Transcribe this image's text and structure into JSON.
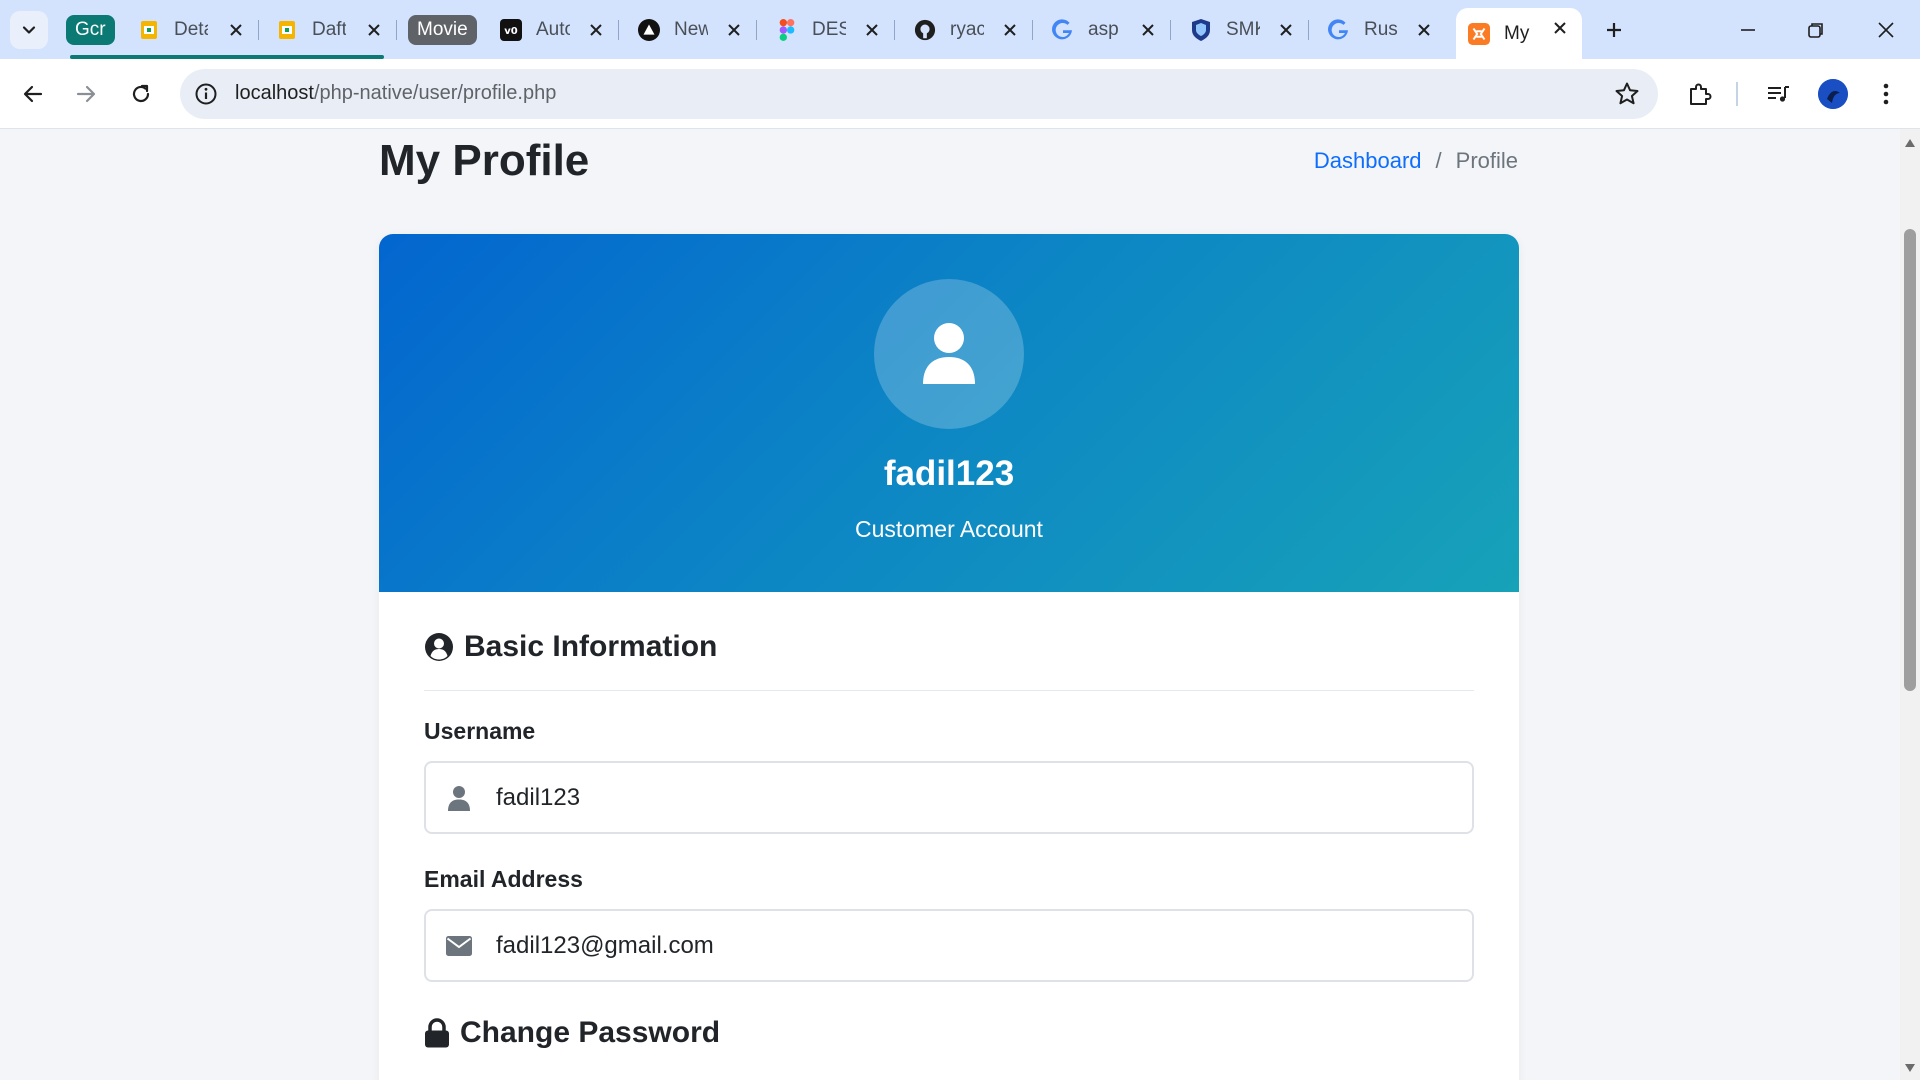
{
  "colors": {
    "tabstrip": "#d3e3fd",
    "accent_blue": "#0d6efd",
    "hero_gradient_start": "#0366d0",
    "hero_gradient_end": "#17a2b8",
    "tab_group_gcr": "#0b7a74",
    "tab_group_movie": "#5f6368"
  },
  "browser": {
    "tab_groups": [
      {
        "label": "Gcr"
      },
      {
        "label": "Movie"
      }
    ],
    "tabs": [
      {
        "title": "Deta",
        "icon": "google-sheets-icon"
      },
      {
        "title": "Daft",
        "icon": "google-sheets-icon"
      },
      {
        "title": "Auto",
        "icon": "v0-icon"
      },
      {
        "title": "New",
        "icon": "triangle-logo-icon"
      },
      {
        "title": "DES",
        "icon": "figma-icon"
      },
      {
        "title": "ryac",
        "icon": "github-icon"
      },
      {
        "title": "asp",
        "icon": "google-icon"
      },
      {
        "title": "SMK",
        "icon": "shield-logo-icon"
      },
      {
        "title": "Rus",
        "icon": "google-icon"
      },
      {
        "title": "My",
        "icon": "xampp-icon",
        "active": true
      }
    ],
    "url_host": "localhost",
    "url_path": "/php-native/user/profile.php"
  },
  "page": {
    "title": "My Profile",
    "breadcrumb": {
      "home": "Dashboard",
      "separator": "/",
      "current": "Profile"
    },
    "hero": {
      "username": "fadil123",
      "role": "Customer Account"
    },
    "basic_info": {
      "heading": "Basic Information",
      "username_label": "Username",
      "username_value": "fadil123",
      "email_label": "Email Address",
      "email_value": "fadil123@gmail.com"
    },
    "password": {
      "heading": "Change Password"
    }
  }
}
